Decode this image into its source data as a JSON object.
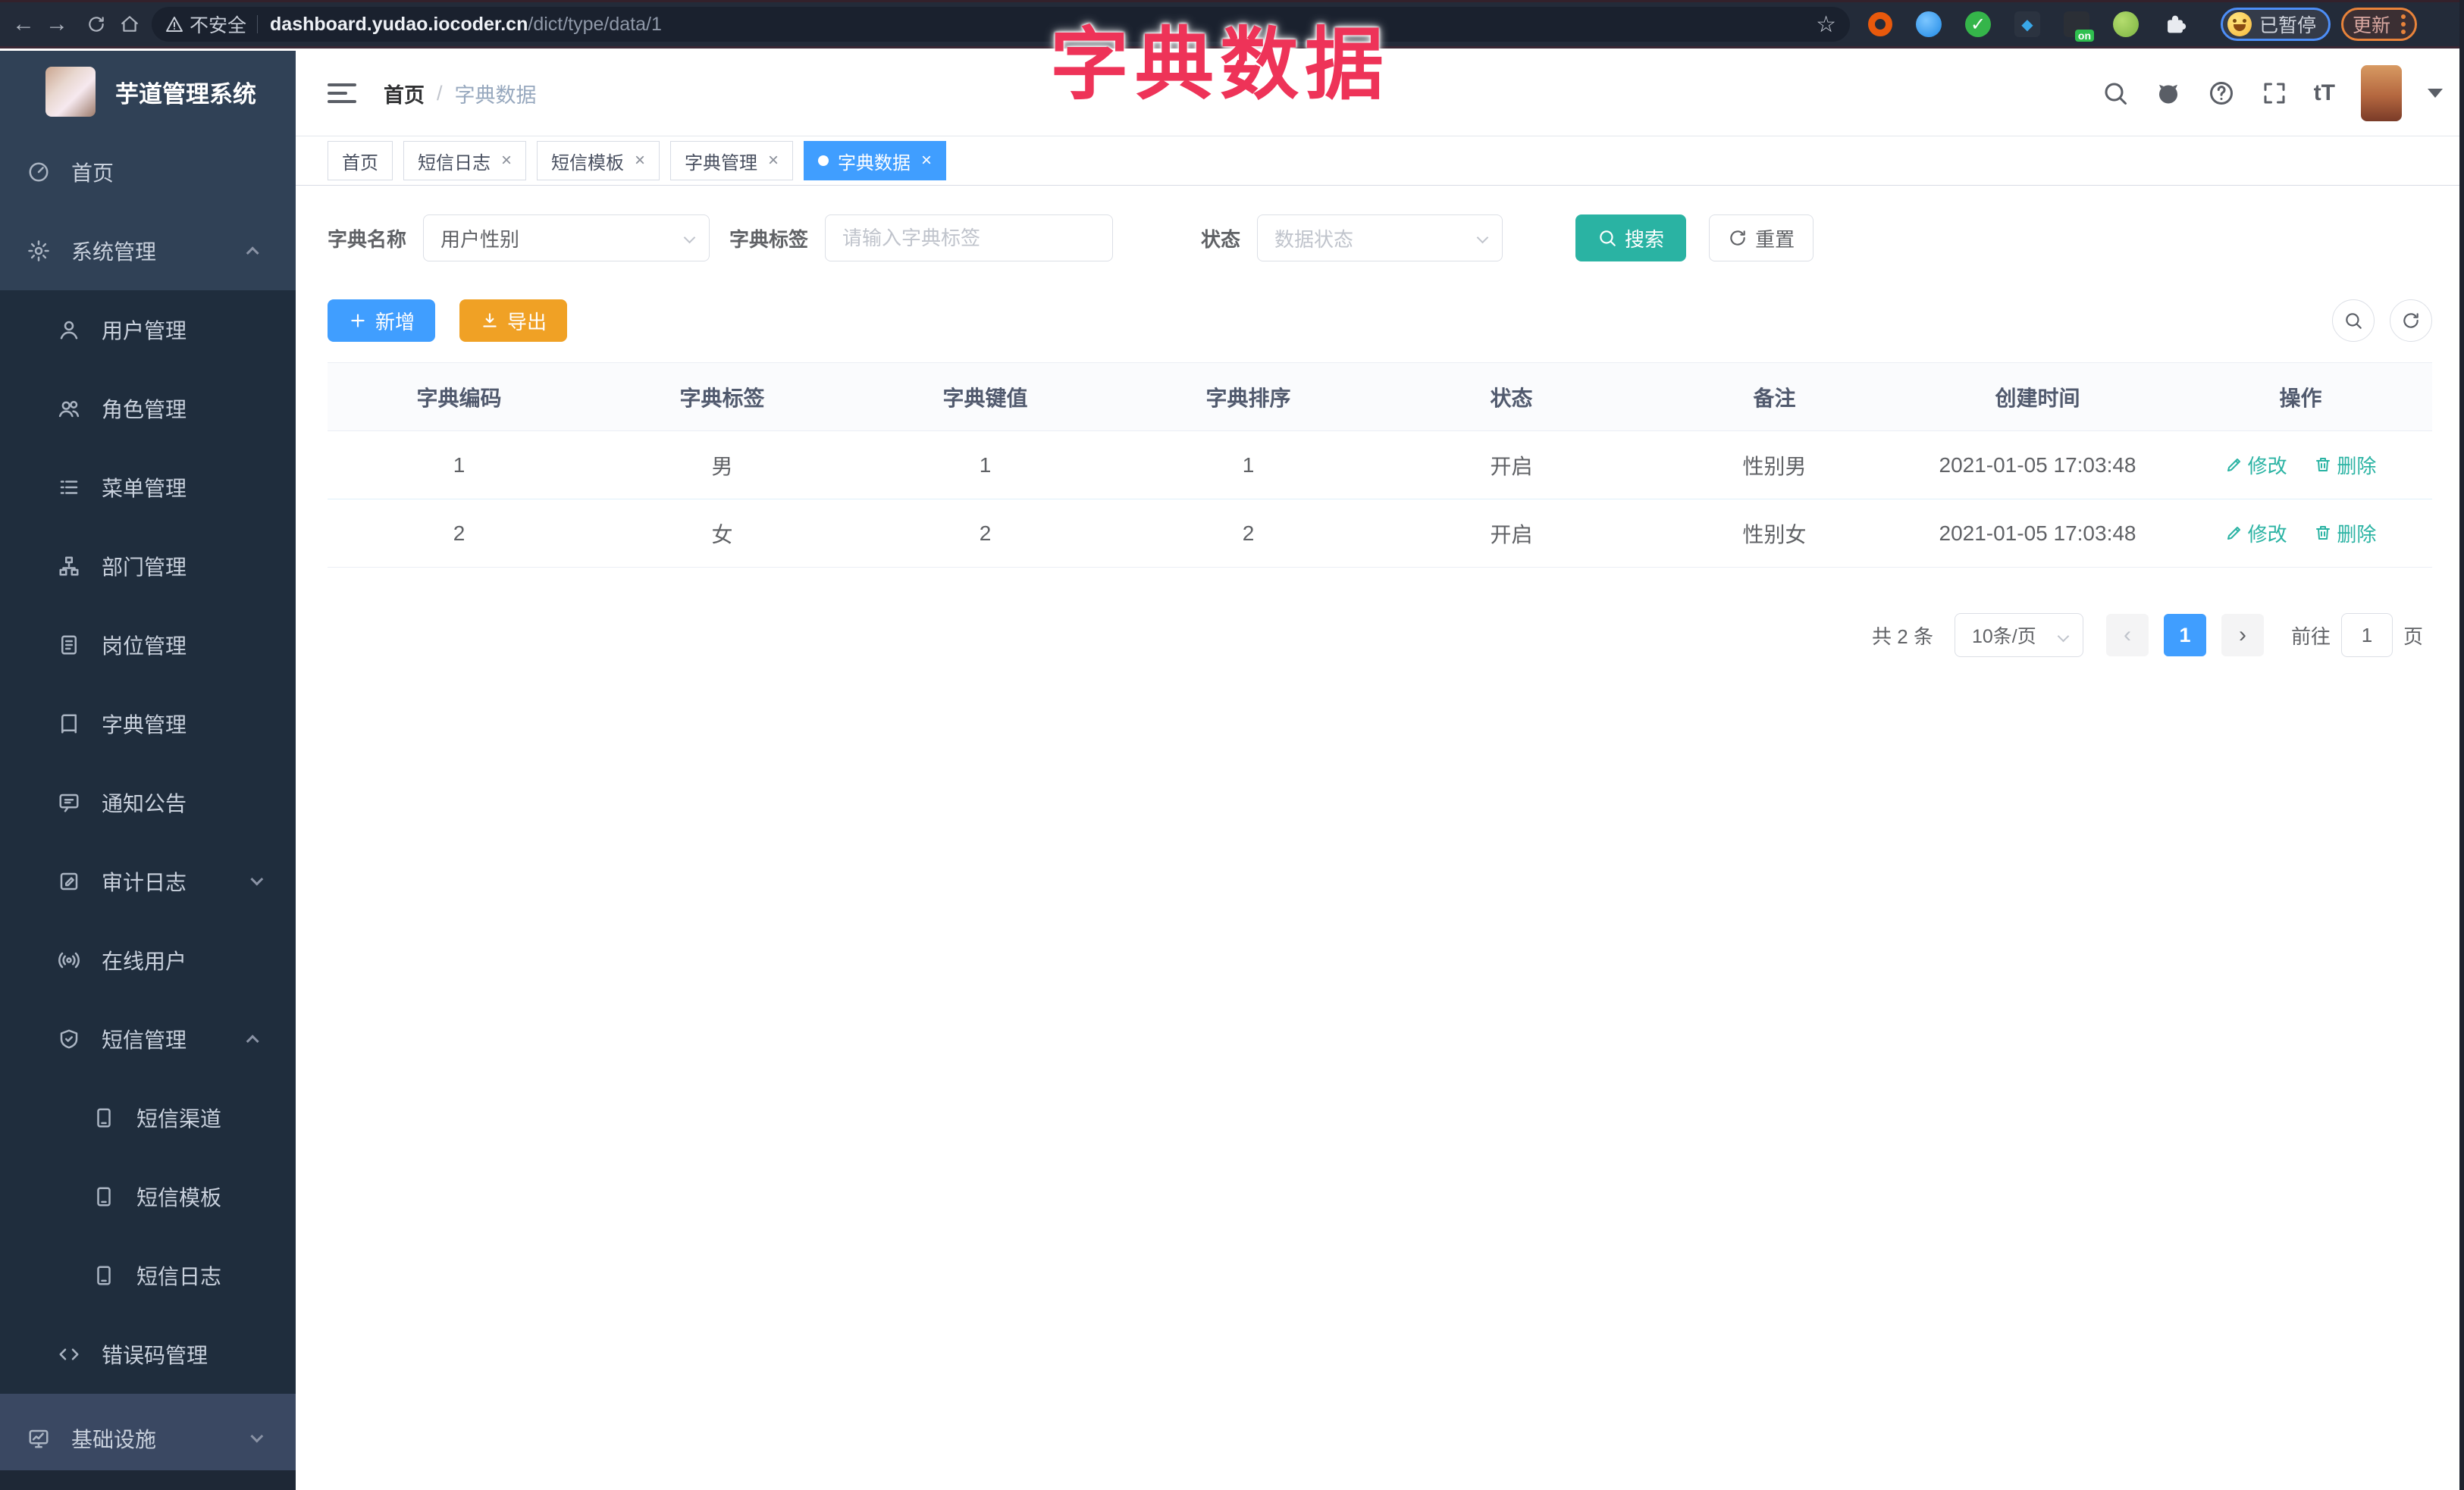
{
  "browser": {
    "security_label": "不安全",
    "url_domain": "dashboard.yudao.iocoder.cn",
    "url_path": "/dict/type/data/1",
    "paused_label": "已暂停",
    "update_label": "更新"
  },
  "icons": {
    "back": "←",
    "forward": "→",
    "star": "☆",
    "check": "✓",
    "diamond": "◆",
    "on_badge": "on",
    "font_size": "tT",
    "close": "×",
    "prev": "‹",
    "next": "›"
  },
  "overlay_title": "字典数据",
  "sidebar": {
    "app_title": "芋道管理系统",
    "items": [
      {
        "label": "首页"
      },
      {
        "label": "系统管理"
      },
      {
        "label": "用户管理"
      },
      {
        "label": "角色管理"
      },
      {
        "label": "菜单管理"
      },
      {
        "label": "部门管理"
      },
      {
        "label": "岗位管理"
      },
      {
        "label": "字典管理"
      },
      {
        "label": "通知公告"
      },
      {
        "label": "审计日志"
      },
      {
        "label": "在线用户"
      },
      {
        "label": "短信管理"
      },
      {
        "label": "短信渠道"
      },
      {
        "label": "短信模板"
      },
      {
        "label": "短信日志"
      },
      {
        "label": "错误码管理"
      },
      {
        "label": "基础设施"
      }
    ]
  },
  "breadcrumb": {
    "home": "首页",
    "separator": "/",
    "current": "字典数据"
  },
  "tabs": [
    {
      "label": "首页"
    },
    {
      "label": "短信日志"
    },
    {
      "label": "短信模板"
    },
    {
      "label": "字典管理"
    },
    {
      "label": "字典数据"
    }
  ],
  "filters": {
    "name_label": "字典名称",
    "name_value": "用户性别",
    "tag_label": "字典标签",
    "tag_placeholder": "请输入字典标签",
    "status_label": "状态",
    "status_placeholder": "数据状态",
    "search_label": "搜索",
    "reset_label": "重置"
  },
  "toolbar": {
    "add_label": "新增",
    "export_label": "导出"
  },
  "table": {
    "headers": [
      "字典编码",
      "字典标签",
      "字典键值",
      "字典排序",
      "状态",
      "备注",
      "创建时间",
      "操作"
    ],
    "rows": [
      {
        "code": "1",
        "label": "男",
        "value": "1",
        "sort": "1",
        "status": "开启",
        "remark": "性别男",
        "created": "2021-01-05 17:03:48",
        "edit": "修改",
        "delete": "删除"
      },
      {
        "code": "2",
        "label": "女",
        "value": "2",
        "sort": "2",
        "status": "开启",
        "remark": "性别女",
        "created": "2021-01-05 17:03:48",
        "edit": "修改",
        "delete": "删除"
      }
    ]
  },
  "pagination": {
    "total": "共 2 条",
    "page_size": "10条/页",
    "page": "1",
    "goto_label": "前往",
    "goto_value": "1",
    "page_unit": "页"
  },
  "colors": {
    "accent_blue": "#409eff",
    "teal": "#2ab3a3",
    "warning_orange": "#f0a125",
    "title_red": "#ee3358",
    "sidebar_bg": "#304156",
    "submenu_bg": "#1f2d3d"
  }
}
